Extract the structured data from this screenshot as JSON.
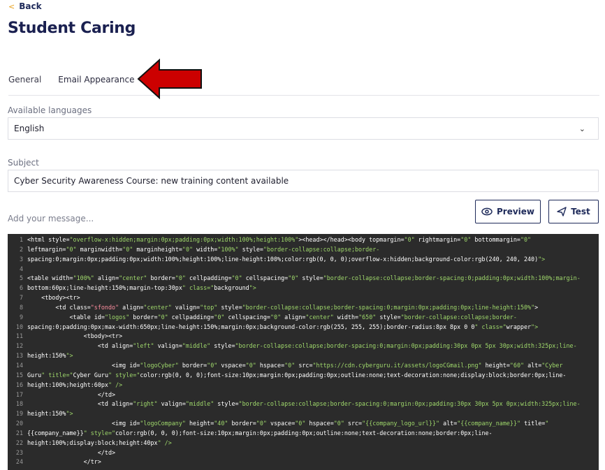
{
  "nav": {
    "back_label": "Back"
  },
  "page": {
    "title": "Student Caring"
  },
  "tabs": [
    {
      "label": "General"
    },
    {
      "label": "Email Appearance"
    }
  ],
  "languages": {
    "label": "Available languages",
    "value": "English"
  },
  "subject": {
    "label": "Subject",
    "value": "Cyber Security Awareness Course: new training content available"
  },
  "message": {
    "placeholder": "Add your message...",
    "preview_label": "Preview",
    "test_label": "Test"
  },
  "colors": {
    "accent": "#1e2a5a",
    "arrow": "#cc0000",
    "back_chevron": "#e8a11e",
    "editor_bg": "#2b2b2b",
    "string": "#9fd86b"
  },
  "code_lines": [
    "<html style=\"overflow-x:hidden;margin:0px;padding:0px;width:100%;height:100%\"><head></head><body topmargin=\"0\" rightmargin=\"0\" bottommargin=\"0\"",
    "leftmargin=\"0\" marginwidth=\"0\" marginheight=\"0\" width=\"100%\" style=\"border-collapse:collapse;border-",
    "spacing:0;margin:0px;padding:0px;width:100%;height:100%;line-height:100%;color:rgb(0, 0, 0);overflow-x:hidden;background-color:rgb(240, 240, 240)\">",
    "",
    "<table width=\"100%\" align=\"center\" border=\"0\" cellpadding=\"0\" cellspacing=\"0\" style=\"border-collapse:collapse;border-spacing:0;padding:0px;width:100%;margin-",
    "bottom:60px;line-height:150%;margin-top:30px\" class=\"background\">",
    "    <tbody><tr>",
    "        <td class=\"sfondo\" align=\"center\" valign=\"top\" style=\"border-collapse:collapse;border-spacing:0;margin:0px;padding:0px;line-height:150%\">",
    "            <table id=\"logos\" border=\"0\" cellpadding=\"0\" cellspacing=\"0\" align=\"center\" width=\"650\" style=\"border-collapse:collapse;border-",
    "spacing:0;padding:0px;max-width:650px;line-height:150%;margin:0px;background-color:rgb(255, 255, 255);border-radius:8px 8px 0 0\" class=\"wrapper\">",
    "                <tbody><tr>",
    "                    <td align=\"left\" valign=\"middle\" style=\"border-collapse:collapse;border-spacing:0;margin:0px;padding:30px 0px 5px 30px;width:325px;line-",
    "height:150%\">",
    "                        <img id=\"logoCyber\" border=\"0\" vspace=\"0\" hspace=\"0\" src=\"https://cdn.cyberguru.it/assets/logoCGmail.png\" height=\"60\" alt=\"Cyber",
    "Guru\" title=\"Cyber Guru\" style=\"color:rgb(0, 0, 0);font-size:10px;margin:0px;padding:0px;outline:none;text-decoration:none;display:block;border:0px;line-",
    "height:100%;height:60px\" />",
    "                    </td>",
    "                    <td align=\"right\" valign=\"middle\" style=\"border-collapse:collapse;border-spacing:0;margin:0px;padding:30px 30px 5px 0px;width:325px;line-",
    "height:150%\">",
    "                        <img id=\"logoCompany\" height=\"40\" border=\"0\" vspace=\"0\" hspace=\"0\" src=\"{{company_logo_url}}\" alt=\"{{company_name}}\" title=\"",
    "{{company_name}}\" style=\"color:rgb(0, 0, 0);font-size:10px;margin:0px;padding:0px;outline:none;text-decoration:none;border:0px;line-",
    "height:100%;display:block;height:40px\" />",
    "                    </td>",
    "                </tr>"
  ]
}
